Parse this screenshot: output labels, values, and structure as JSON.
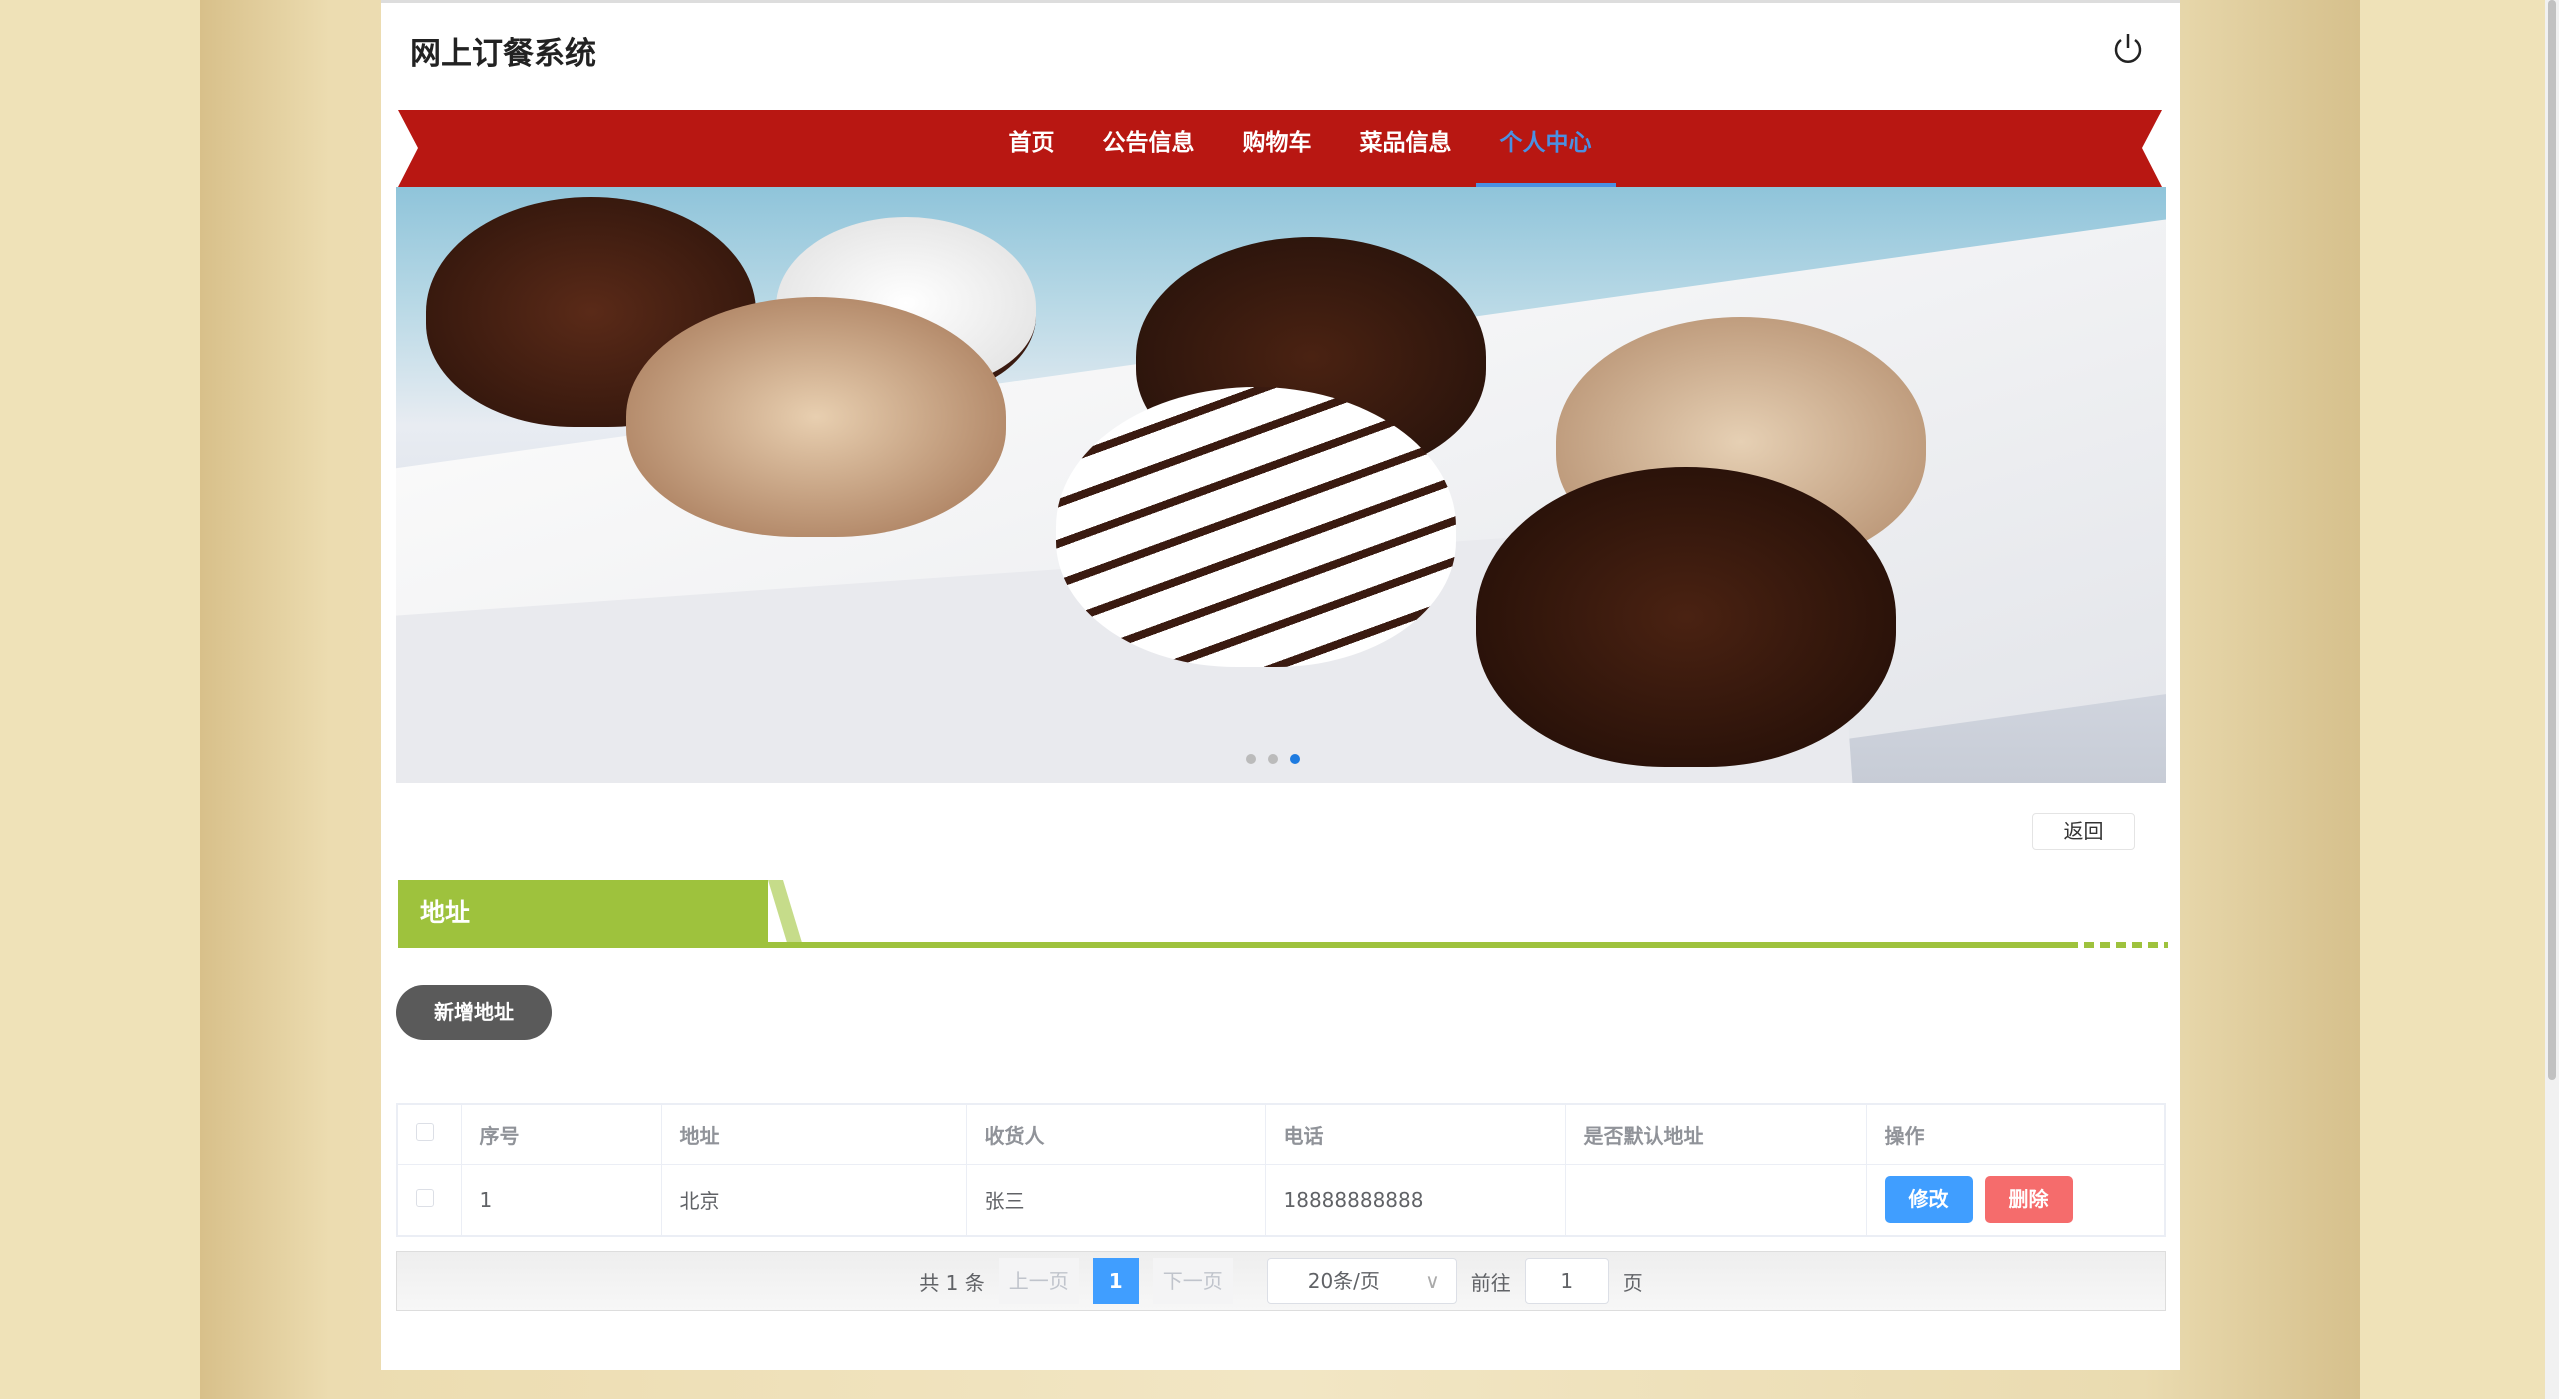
{
  "header": {
    "title": "网上订餐系统",
    "logout_icon": "power-icon"
  },
  "nav": {
    "items": [
      {
        "label": "首页"
      },
      {
        "label": "公告信息"
      },
      {
        "label": "购物车"
      },
      {
        "label": "菜品信息"
      },
      {
        "label": "个人中心",
        "active": true
      }
    ],
    "bg_color": "#b81712",
    "active_color": "#4a90e2"
  },
  "banner": {
    "slides": 3,
    "active_slide": 3
  },
  "back_label": "返回",
  "section": {
    "title": "地址",
    "color": "#9ec23d"
  },
  "add_label": "新增地址",
  "table": {
    "columns": [
      "序号",
      "地址",
      "收货人",
      "电话",
      "是否默认地址",
      "操作"
    ],
    "rows": [
      {
        "index": "1",
        "address": "北京",
        "receiver": "张三",
        "phone": "18888888888",
        "is_default": "",
        "edit": "修改",
        "delete": "删除"
      }
    ]
  },
  "pagination": {
    "total": "共 1 条",
    "prev": "上一页",
    "current": "1",
    "next": "下一页",
    "page_size": "20条/页",
    "goto": "前往",
    "goto_value": "1",
    "page_unit": "页"
  }
}
